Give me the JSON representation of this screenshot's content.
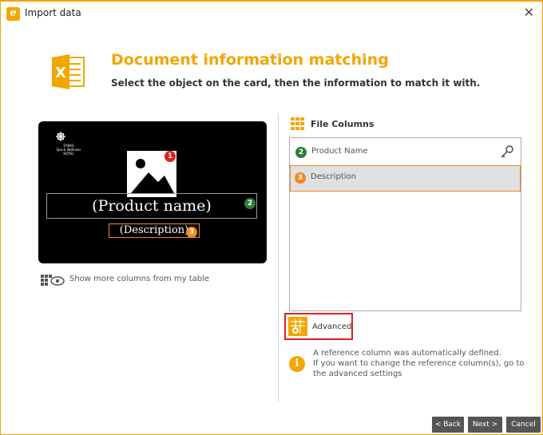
{
  "window": {
    "title": "Import data",
    "close_glyph": "✕",
    "app_icon_letter": "e"
  },
  "header": {
    "icon": "excel-icon",
    "title": "Document information matching",
    "subtitle": "Select the object on the card, then the information to match it with."
  },
  "card": {
    "background": "#000000",
    "logo_lines": [
      "SYBAS",
      "Spa & Wellness",
      "HOTEL"
    ],
    "image_badge": "1",
    "name_field": {
      "text": "(Product name)",
      "badge": "2"
    },
    "desc_field": {
      "text": "(Description)",
      "badge": "3"
    }
  },
  "show_more": {
    "icon": "columns-eye-icon",
    "label": "Show more columns from my table"
  },
  "file_columns": {
    "label": "File Columns",
    "icon": "grid-icon",
    "items": [
      {
        "badge": "2",
        "name": "Product Name",
        "badge_color": "#2e7d3a",
        "is_reference": true,
        "icon": "key-icon"
      },
      {
        "badge": "3",
        "name": "Description",
        "badge_color": "#f08a1c",
        "selected": true
      }
    ]
  },
  "advanced": {
    "label": "Advanced",
    "icon": "advanced-settings-icon"
  },
  "info": {
    "icon": "info-icon",
    "lines": [
      "A reference column was automatically defined.",
      "If you want to change the reference column(s), go to",
      "the advanced settings"
    ]
  },
  "buttons": {
    "back": "< Back",
    "next": "Next >",
    "cancel": "Cancel"
  },
  "colors": {
    "accent": "#f2a600",
    "selected_border": "#f08a1c",
    "highlight_red": "#e02020"
  }
}
